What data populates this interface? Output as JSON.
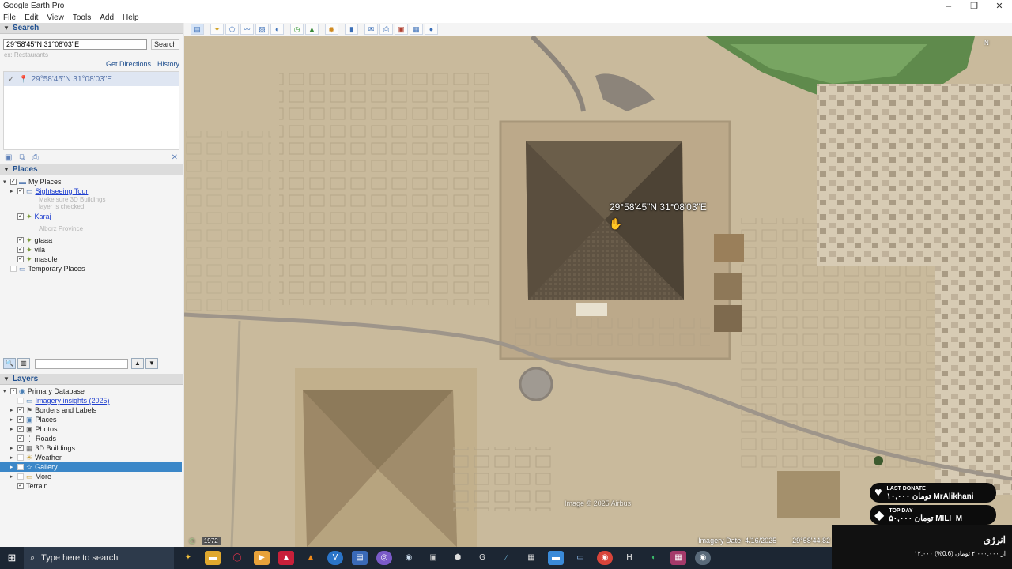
{
  "window": {
    "title": "Google Earth Pro",
    "controls": [
      "–",
      "❐",
      "✕"
    ]
  },
  "menu": [
    "File",
    "Edit",
    "View",
    "Tools",
    "Add",
    "Help"
  ],
  "search": {
    "header": "Search",
    "value": "29°58'45\"N 31°08'03\"E",
    "button": "Search",
    "hint": "ex: Restaurants",
    "get_directions": "Get Directions",
    "history": "History",
    "result": "29°58'45\"N 31°08'03\"E"
  },
  "places": {
    "header": "Places",
    "items": [
      {
        "label": "My Places",
        "link": false,
        "sub": ""
      },
      {
        "label": "Sightseeing Tour",
        "link": true,
        "sub": "Make sure 3D Buildings layer is checked"
      },
      {
        "label": "Karaj",
        "link": true,
        "sub": "Alborz Province"
      },
      {
        "label": "gtaaa",
        "link": false,
        "sub": ""
      },
      {
        "label": "vila",
        "link": false,
        "sub": ""
      },
      {
        "label": "masole",
        "link": false,
        "sub": ""
      },
      {
        "label": "Temporary Places",
        "link": false,
        "sub": ""
      }
    ]
  },
  "layers": {
    "header": "Layers",
    "items": [
      {
        "label": "Primary Database",
        "link": false
      },
      {
        "label": "Imagery insights (2025)",
        "link": true
      },
      {
        "label": "Borders and Labels",
        "link": false
      },
      {
        "label": "Places",
        "link": false
      },
      {
        "label": "Photos",
        "link": false
      },
      {
        "label": "Roads",
        "link": false
      },
      {
        "label": "3D Buildings",
        "link": false
      },
      {
        "label": "Weather",
        "link": false
      },
      {
        "label": "Gallery",
        "link": false
      },
      {
        "label": "More",
        "link": false
      },
      {
        "label": "Terrain",
        "link": false
      }
    ],
    "selected": "Gallery"
  },
  "map": {
    "placemark_label": "29°58'45\"N 31°08'03\"E",
    "copyright": "Image © 2025 Airbus",
    "imagery_date": "Imagery Date: 4/16/2025",
    "coords_readout": "29°58'44.82",
    "year_badge": "1972",
    "compass": "N"
  },
  "taskbar": {
    "search_placeholder": "Type here to search"
  },
  "stream_overlay": {
    "last_donate_tag": "LAST DONATE",
    "last_donate_value": "۱۰,۰۰۰ تومان  MrAlikhani",
    "top_day_tag": "TOP DAY",
    "top_day_value": "۵۰,۰۰۰ تومان  MILI_M",
    "energy_title": "انرژی",
    "energy_value": "۱۲,۰۰۰ از ۲,۰۰۰,۰۰۰ تومان (0.6%)"
  },
  "colors": {
    "accent": "#1f4f8f",
    "selection": "#3b87c8",
    "taskbar": "#1c2633",
    "map_sand": "#c8b89a"
  }
}
